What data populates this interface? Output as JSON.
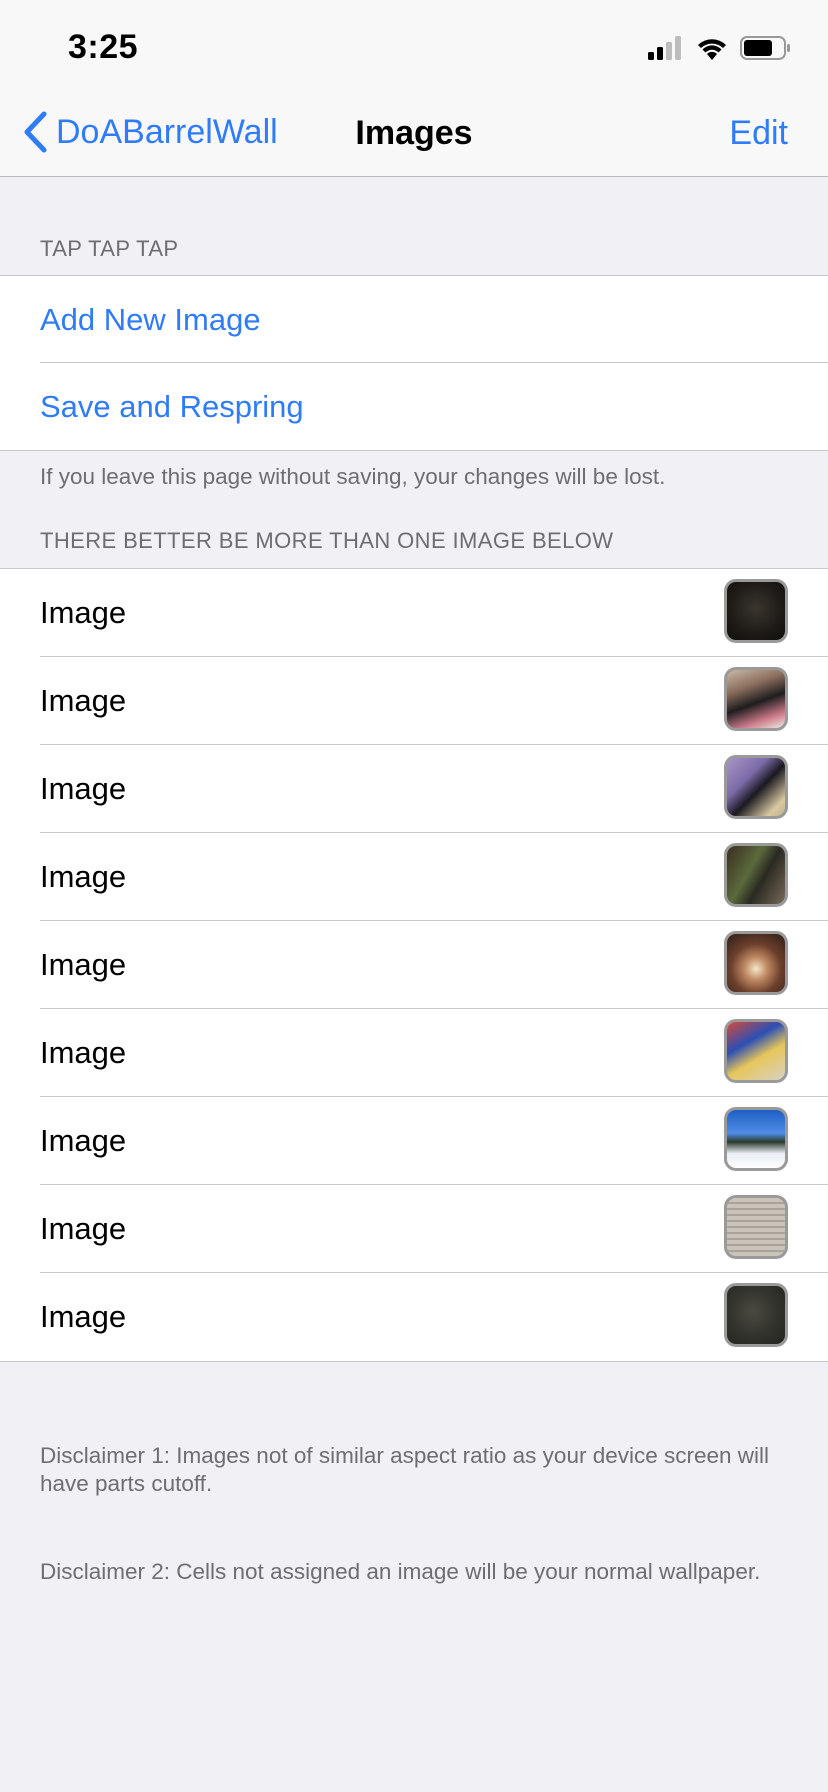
{
  "status": {
    "time": "3:25"
  },
  "nav": {
    "back_label": "DoABarrelWall",
    "title": "Images",
    "edit_label": "Edit"
  },
  "section1": {
    "header": "TAP TAP TAP",
    "items": [
      "Add New Image",
      "Save and Respring"
    ],
    "footer": "If you leave this page without saving, your changes will be lost."
  },
  "section2": {
    "header": "THERE BETTER BE MORE THAN ONE IMAGE BELOW",
    "items": [
      {
        "label": "Image",
        "thumb": "dark photo of cat"
      },
      {
        "label": "Image",
        "thumb": "cat in room"
      },
      {
        "label": "Image",
        "thumb": "cat on purple blanket"
      },
      {
        "label": "Image",
        "thumb": "cat with plants"
      },
      {
        "label": "Image",
        "thumb": "sparks on table"
      },
      {
        "label": "Image",
        "thumb": "colorful objects"
      },
      {
        "label": "Image",
        "thumb": "snowy mountain"
      },
      {
        "label": "Image",
        "thumb": "handwritten notebook page"
      },
      {
        "label": "Image",
        "thumb": "ceiling fan"
      }
    ]
  },
  "disclaimers": [
    "Disclaimer 1: Images not of similar aspect ratio as your device screen will have parts cutoff.",
    "Disclaimer 2: Cells not assigned an image will be your normal wallpaper."
  ],
  "colors": {
    "accent": "#2f7cf6",
    "background": "#f0f0f5",
    "secondary_text": "#6d6d72"
  }
}
